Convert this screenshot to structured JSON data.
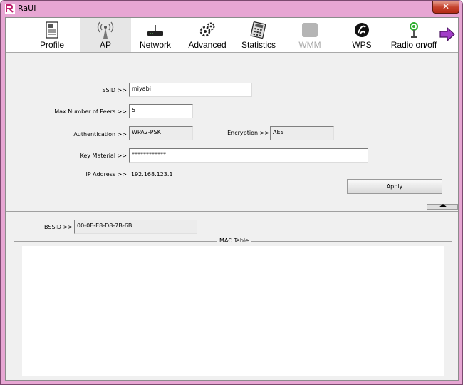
{
  "window": {
    "title": "RaUI",
    "close_glyph": "✕"
  },
  "toolbar": {
    "items": [
      {
        "label": "Profile",
        "icon": "profile-icon"
      },
      {
        "label": "AP",
        "icon": "ap-antenna-icon",
        "active": true
      },
      {
        "label": "Network",
        "icon": "router-icon"
      },
      {
        "label": "Advanced",
        "icon": "gears-icon"
      },
      {
        "label": "Statistics",
        "icon": "calculator-icon"
      },
      {
        "label": "WMM",
        "icon": "wmm-icon",
        "disabled": true
      },
      {
        "label": "WPS",
        "icon": "wps-icon"
      },
      {
        "label": "Radio on/off",
        "icon": "radio-icon"
      }
    ],
    "next_icon": "arrow-right-icon"
  },
  "form": {
    "ssid_label": "SSID >>",
    "ssid_value": "miyabi",
    "max_peers_label": "Max Number of Peers >>",
    "max_peers_value": "5",
    "auth_label": "Authentication >>",
    "auth_value": "WPA2-PSK",
    "encryption_label": "Encryption >>",
    "encryption_value": "AES",
    "key_label": "Key Material >>",
    "key_value": "************",
    "ip_label": "IP Address >>",
    "ip_value": "192.168.123.1",
    "apply_label": "Apply"
  },
  "bssid": {
    "label": "BSSID >>",
    "value": "00-0E-E8-D8-7B-6B"
  },
  "mac_table": {
    "title": "MAC Table"
  },
  "colors": {
    "title_bar": "#e7a6d3",
    "client_bg": "#f0f0f0",
    "active_tab": "#e6e6e6",
    "radio_green": "#2fae2f",
    "next_arrow": "#a23ec8"
  }
}
